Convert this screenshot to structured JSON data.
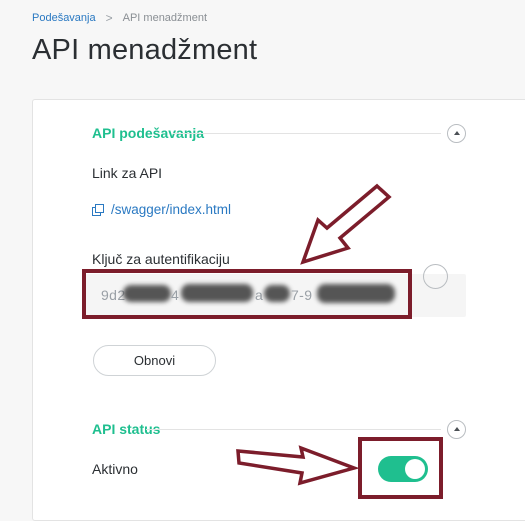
{
  "breadcrumb": {
    "parent": "Podešavanja",
    "separator": ">",
    "current": "API menadžment"
  },
  "page_title": "API menadžment",
  "api_settings": {
    "title": "API podešavanja",
    "link_label": "Link za API",
    "link_text": "/swagger/index.html",
    "auth_key_label": "Ključ za autentifikaciju",
    "auth_key_prefix": "9d2",
    "auth_key_fragments": [
      "4",
      "a",
      "7-9"
    ],
    "refresh_button": "Obnovi"
  },
  "api_status": {
    "title": "API status",
    "active_label": "Aktivno",
    "active": true
  },
  "colors": {
    "accent": "#1fbf8f",
    "link": "#2a79c2",
    "annotation": "#7c1d2b"
  }
}
